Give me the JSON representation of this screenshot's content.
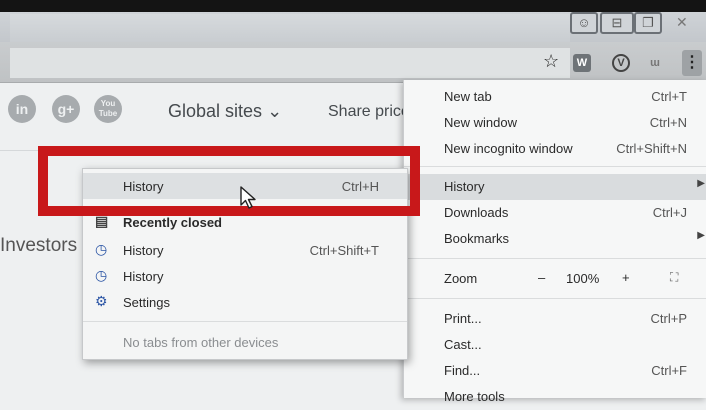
{
  "window": {
    "controls": [
      "⊟",
      "❐",
      "✕"
    ]
  },
  "toolbar": {
    "star_glyph": "☆",
    "ext1": "W",
    "ext2": "V",
    "ext3": "ɯ",
    "menu_glyph": "⋮"
  },
  "page": {
    "social": [
      "in",
      "g+",
      "You Tube"
    ],
    "global_sites": "Global sites",
    "share_price": "Share price",
    "investors": "Investors"
  },
  "menu": {
    "items": [
      {
        "label": "New tab",
        "shortcut": "Ctrl+T"
      },
      {
        "label": "New window",
        "shortcut": "Ctrl+N"
      },
      {
        "label": "New incognito window",
        "shortcut": "Ctrl+Shift+N"
      },
      {
        "label": "History",
        "shortcut": ""
      },
      {
        "label": "Downloads",
        "shortcut": "Ctrl+J"
      },
      {
        "label": "Bookmarks",
        "shortcut": ""
      },
      {
        "label": "Zoom",
        "shortcut": ""
      },
      {
        "label": "Print...",
        "shortcut": "Ctrl+P"
      },
      {
        "label": "Cast...",
        "shortcut": ""
      },
      {
        "label": "Find...",
        "shortcut": "Ctrl+F"
      },
      {
        "label": "More tools",
        "shortcut": ""
      }
    ],
    "zoom": {
      "minus": "–",
      "value": "100%",
      "plus": "+"
    }
  },
  "history_submenu": {
    "items": [
      {
        "label": "History",
        "shortcut": "Ctrl+H"
      },
      {
        "label": "Recently closed",
        "shortcut": ""
      },
      {
        "label": "History",
        "shortcut": "Ctrl+Shift+T"
      },
      {
        "label": "History",
        "shortcut": ""
      },
      {
        "label": "Settings",
        "shortcut": ""
      }
    ],
    "no_tabs": "No tabs from other devices"
  },
  "colors": {
    "annotation_red": "#c8181a",
    "highlight": "#d9dcde"
  }
}
